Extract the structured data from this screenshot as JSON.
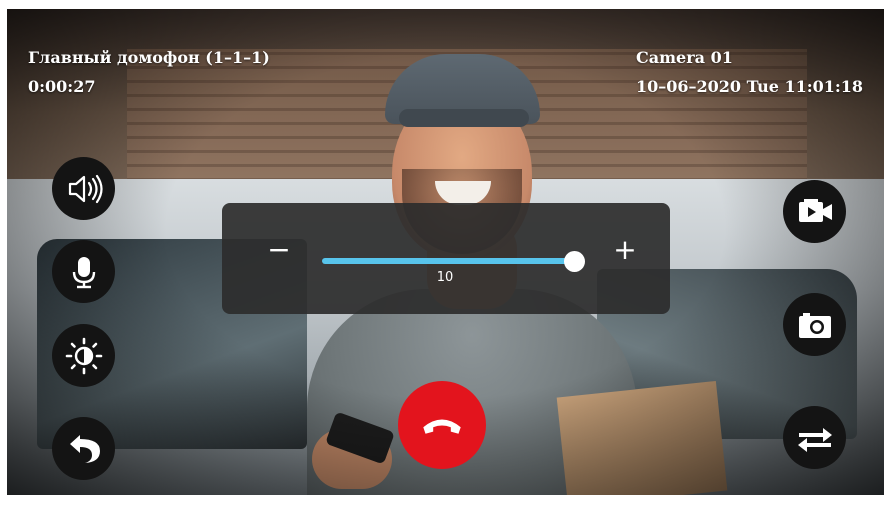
{
  "header": {
    "intercom_name": "Главный домофон (1–1–1)",
    "call_duration": "0:00:27",
    "camera_name": "Camera 01",
    "datetime": "10–06–2020  Tue  11:01:18"
  },
  "left_controls": [
    {
      "name": "speaker-volume",
      "icon": "speaker-icon"
    },
    {
      "name": "microphone",
      "icon": "microphone-icon"
    },
    {
      "name": "brightness",
      "icon": "brightness-icon"
    },
    {
      "name": "back",
      "icon": "back-arrow-icon"
    }
  ],
  "right_controls": [
    {
      "name": "record-video",
      "icon": "video-record-icon"
    },
    {
      "name": "snapshot",
      "icon": "camera-icon"
    },
    {
      "name": "switch-camera",
      "icon": "swap-arrows-icon"
    }
  ],
  "call": {
    "hangup_icon": "hangup-phone-icon",
    "hangup_color": "#e3141d"
  },
  "volume_panel": {
    "minus": "−",
    "plus": "+",
    "value": "10",
    "level_fraction": 1.0,
    "accent": "#58c4ec"
  }
}
